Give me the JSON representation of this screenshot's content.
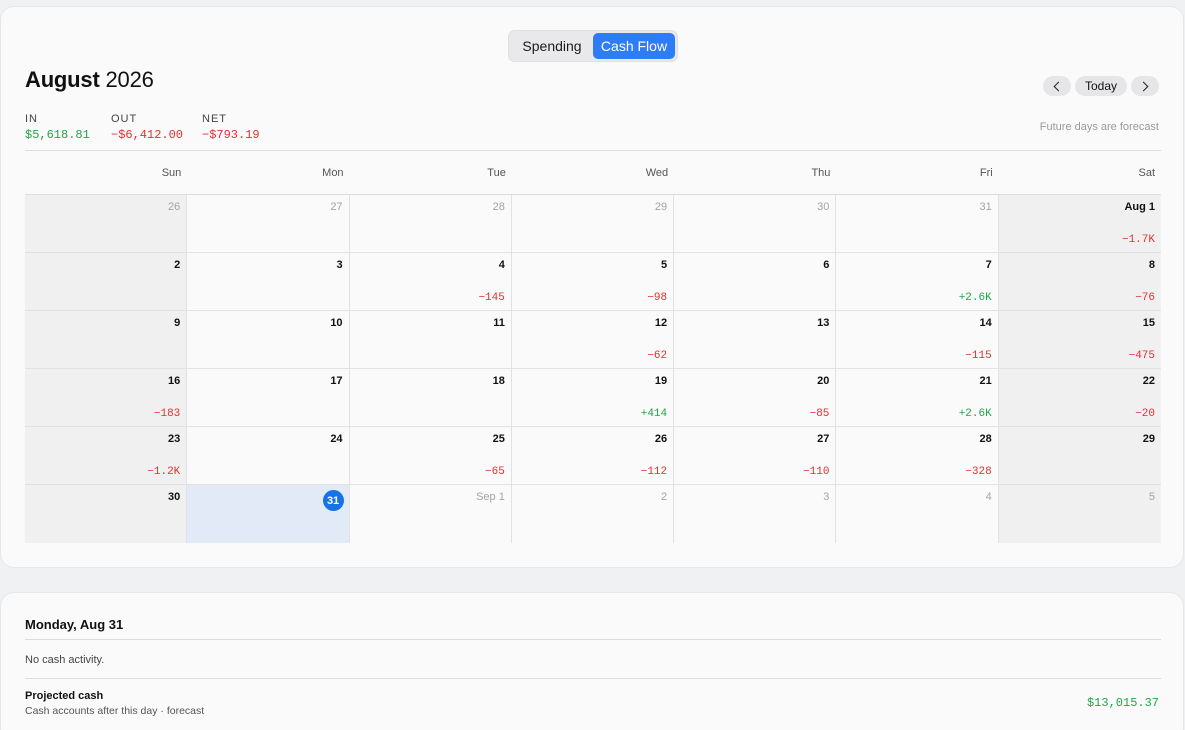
{
  "view_toggle": {
    "spending": "Spending",
    "cash_flow": "Cash Flow",
    "active": "cash_flow"
  },
  "header": {
    "month": "August",
    "year": "2026"
  },
  "nav": {
    "today": "Today",
    "prev_icon": "chevron-left-icon",
    "next_icon": "chevron-right-icon"
  },
  "summary": {
    "in_label": "IN",
    "in_value": "$5,618.81",
    "out_label": "OUT",
    "out_value": "−$6,412.00",
    "net_label": "NET",
    "net_value": "−$793.19"
  },
  "forecast_note": "Future days are forecast",
  "weekdays": [
    "Sun",
    "Mon",
    "Tue",
    "Wed",
    "Thu",
    "Fri",
    "Sat"
  ],
  "weeks": [
    [
      {
        "day": "26",
        "muted": true
      },
      {
        "day": "27",
        "muted": true
      },
      {
        "day": "28",
        "muted": true
      },
      {
        "day": "29",
        "muted": true
      },
      {
        "day": "30",
        "muted": true
      },
      {
        "day": "31",
        "muted": true
      },
      {
        "day": "Aug 1",
        "amount": "−1.7K",
        "sign": "neg"
      }
    ],
    [
      {
        "day": "2"
      },
      {
        "day": "3"
      },
      {
        "day": "4",
        "amount": "−145",
        "sign": "neg"
      },
      {
        "day": "5",
        "amount": "−98",
        "sign": "neg"
      },
      {
        "day": "6"
      },
      {
        "day": "7",
        "amount": "+2.6K",
        "sign": "pos"
      },
      {
        "day": "8",
        "amount": "−76",
        "sign": "neg"
      }
    ],
    [
      {
        "day": "9"
      },
      {
        "day": "10"
      },
      {
        "day": "11"
      },
      {
        "day": "12",
        "amount": "−62",
        "sign": "neg"
      },
      {
        "day": "13"
      },
      {
        "day": "14",
        "amount": "−115",
        "sign": "neg"
      },
      {
        "day": "15",
        "amount": "−475",
        "sign": "neg"
      }
    ],
    [
      {
        "day": "16",
        "amount": "−183",
        "sign": "neg"
      },
      {
        "day": "17"
      },
      {
        "day": "18"
      },
      {
        "day": "19",
        "amount": "+414",
        "sign": "pos"
      },
      {
        "day": "20",
        "amount": "−85",
        "sign": "neg"
      },
      {
        "day": "21",
        "amount": "+2.6K",
        "sign": "pos"
      },
      {
        "day": "22",
        "amount": "−20",
        "sign": "neg"
      }
    ],
    [
      {
        "day": "23",
        "amount": "−1.2K",
        "sign": "neg"
      },
      {
        "day": "24"
      },
      {
        "day": "25",
        "amount": "−65",
        "sign": "neg"
      },
      {
        "day": "26",
        "amount": "−112",
        "sign": "neg"
      },
      {
        "day": "27",
        "amount": "−110",
        "sign": "neg"
      },
      {
        "day": "28",
        "amount": "−328",
        "sign": "neg"
      },
      {
        "day": "29"
      }
    ],
    [
      {
        "day": "30"
      },
      {
        "day": "31",
        "today": true,
        "selected": true
      },
      {
        "day": "Sep 1",
        "muted": true
      },
      {
        "day": "2",
        "muted": true
      },
      {
        "day": "3",
        "muted": true
      },
      {
        "day": "4",
        "muted": true
      },
      {
        "day": "5",
        "muted": true
      }
    ]
  ],
  "detail": {
    "title": "Monday, Aug 31",
    "empty": "No cash activity.",
    "projected_title": "Projected cash",
    "projected_sub": "Cash accounts after this day · forecast",
    "projected_value": "$13,015.37"
  },
  "colors": {
    "accent": "#2f7df6",
    "today": "#1673e6",
    "positive": "#1fa64a",
    "negative": "#e03030",
    "selected_bg": "#e2eaf7"
  }
}
